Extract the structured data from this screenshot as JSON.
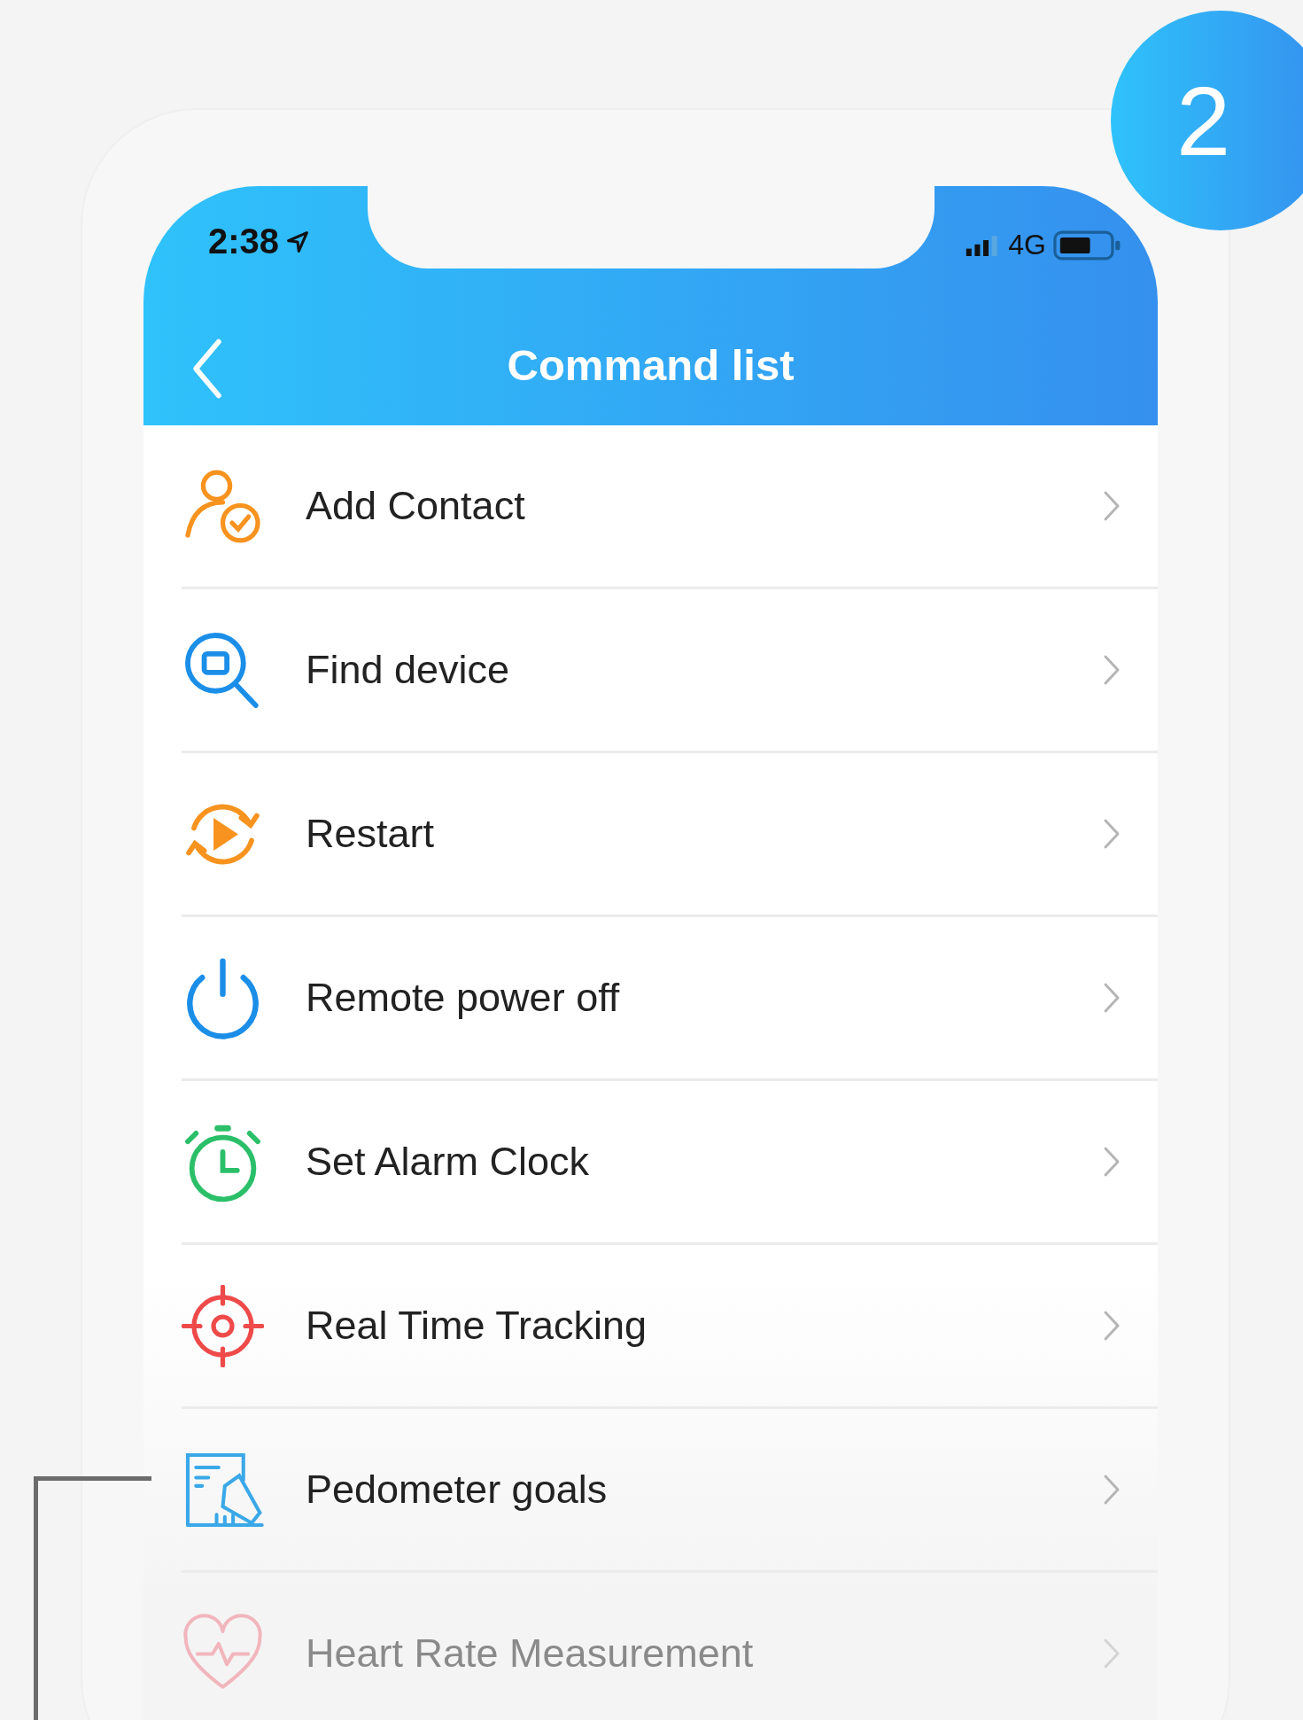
{
  "badge": "2",
  "status_bar": {
    "time": "2:38",
    "network": "4G"
  },
  "header": {
    "title": "Command list"
  },
  "commands": [
    {
      "label": "Add Contact",
      "kind": "contact",
      "faded": false
    },
    {
      "label": "Find device",
      "kind": "find",
      "faded": false
    },
    {
      "label": "Restart",
      "kind": "restart",
      "faded": false
    },
    {
      "label": "Remote power off",
      "kind": "power",
      "faded": false
    },
    {
      "label": "Set Alarm Clock",
      "kind": "alarm",
      "faded": false
    },
    {
      "label": "Real Time Tracking",
      "kind": "tracking",
      "faded": false
    },
    {
      "label": "Pedometer goals",
      "kind": "pedometer",
      "faded": false
    },
    {
      "label": "Heart Rate Measurement",
      "kind": "heart",
      "faded": true
    }
  ]
}
